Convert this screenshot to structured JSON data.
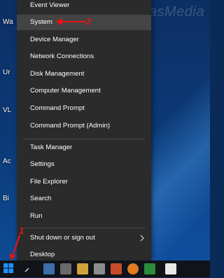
{
  "watermark": "TermasMedia",
  "desktop_labels": [
    "Wa",
    "Ur",
    "VL",
    "Ac",
    "Bi"
  ],
  "menu": {
    "items": [
      "Event Viewer",
      "System",
      "Device Manager",
      "Network Connections",
      "Disk Management",
      "Computer Management",
      "Command Prompt",
      "Command Prompt (Admin)",
      "Task Manager",
      "Settings",
      "File Explorer",
      "Search",
      "Run",
      "Shut down or sign out",
      "Desktop"
    ],
    "highlighted": "System"
  },
  "annotations": [
    "1",
    "2"
  ],
  "colors": {
    "menu_bg": "#2b2b2b",
    "menu_highlight": "#444444",
    "annotation": "#e11111",
    "windows_logo": "#1e90ff"
  },
  "icons": [
    "windows-start-icon",
    "chevron-right-icon",
    "red-arrow-icon"
  ]
}
